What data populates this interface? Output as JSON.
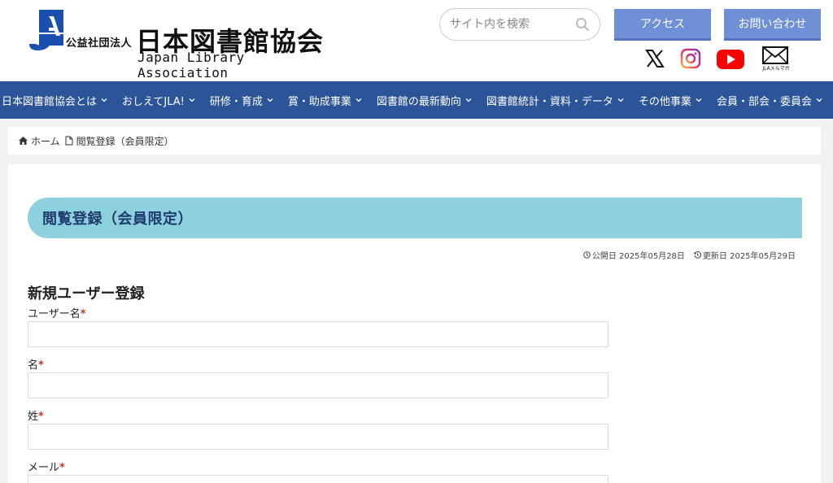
{
  "header": {
    "logo": {
      "corp_type": "公益社団法人",
      "name_jp": "日本図書館協会",
      "name_en": "Japan Library Association",
      "mark_letters": "JLA"
    },
    "search": {
      "placeholder": "サイト内を検索"
    },
    "buttons": {
      "access": "アクセス",
      "contact": "お問い合わせ"
    },
    "social": {
      "x": "x-icon",
      "instagram": "instagram-icon",
      "youtube": "youtube-icon",
      "mail_caption": "JLAメルマガ"
    }
  },
  "nav": {
    "items": [
      {
        "label": "日本図書館協会とは"
      },
      {
        "label": "おしえてJLA!"
      },
      {
        "label": "研修・育成"
      },
      {
        "label": "賞・助成事業"
      },
      {
        "label": "図書館の最新動向"
      },
      {
        "label": "図書館統計・資料・データ"
      },
      {
        "label": "その他事業"
      },
      {
        "label": "会員・部会・委員会"
      }
    ]
  },
  "breadcrumb": {
    "home": "ホーム",
    "current": "閲覧登録（会員限定）"
  },
  "page": {
    "title": "閲覧登録（会員限定）",
    "published": "公開日 2025年05月28日",
    "updated": "更新日 2025年05月29日"
  },
  "form": {
    "title": "新規ユーザー登録",
    "required_mark": "*",
    "fields": [
      {
        "label": "ユーザー名",
        "value": ""
      },
      {
        "label": "名",
        "value": ""
      },
      {
        "label": "姓",
        "value": ""
      },
      {
        "label": "メール",
        "value": ""
      }
    ]
  },
  "colors": {
    "nav_bg": "#2c5599",
    "button_bg": "#6f8fd6",
    "title_bar_bg": "#8dd0de",
    "title_text": "#1f3b6e",
    "required": "#c0392b"
  }
}
